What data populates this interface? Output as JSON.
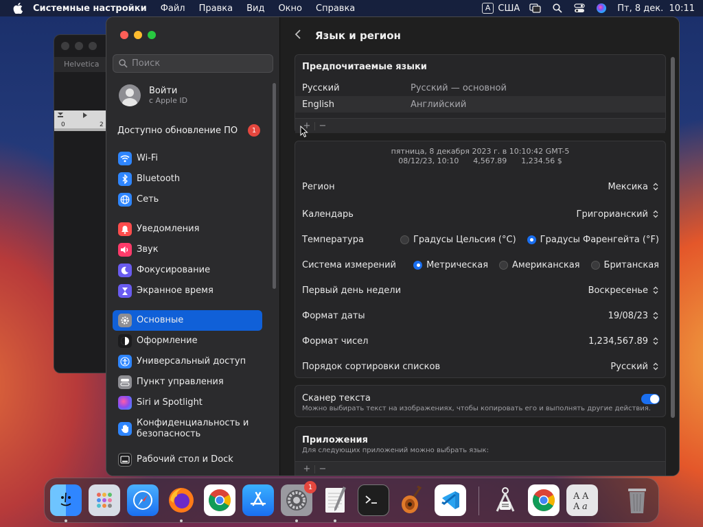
{
  "menubar": {
    "app_name": "Системные настройки",
    "items": [
      "Файл",
      "Правка",
      "Вид",
      "Окно",
      "Справка"
    ],
    "input_source_letter": "A",
    "input_source": "США",
    "datetime": "Пт, 8 дек.  10:11"
  },
  "background_window": {
    "tab": "Helvetica",
    "ruler_start": "0",
    "ruler_mark": "2"
  },
  "sidebar": {
    "search_placeholder": "Поиск",
    "account": {
      "title": "Войти",
      "subtitle": "с Apple ID"
    },
    "update": {
      "label": "Доступно обновление ПО",
      "badge": "1"
    },
    "group1": [
      {
        "label": "Wi-Fi",
        "icon": "wifi-icon",
        "color": "#2f86ff"
      },
      {
        "label": "Bluetooth",
        "icon": "bluetooth-icon",
        "color": "#2f86ff"
      },
      {
        "label": "Сеть",
        "icon": "globe-icon",
        "color": "#2f86ff"
      }
    ],
    "group2": [
      {
        "label": "Уведомления",
        "icon": "bell-icon",
        "color": "#ff4d4d"
      },
      {
        "label": "Звук",
        "icon": "speaker-icon",
        "color": "#ff3b6a"
      },
      {
        "label": "Фокусирование",
        "icon": "moon-icon",
        "color": "#6a5cf0"
      },
      {
        "label": "Экранное время",
        "icon": "hourglass-icon",
        "color": "#6a5cf0"
      }
    ],
    "group3": [
      {
        "label": "Основные",
        "icon": "gear-icon",
        "color": "#8e8e93"
      },
      {
        "label": "Оформление",
        "icon": "appearance-icon",
        "color": "#1c1c1e"
      },
      {
        "label": "Универсальный доступ",
        "icon": "accessibility-icon",
        "color": "#2f86ff"
      },
      {
        "label": "Пункт управления",
        "icon": "control-center-icon",
        "color": "#8e8e93"
      },
      {
        "label": "Siri и Spotlight",
        "icon": "siri-icon",
        "color": "#b04ce0"
      },
      {
        "label": "Конфиденциальность и безопасность",
        "icon": "hand-icon",
        "color": "#2f86ff"
      }
    ],
    "group4": [
      {
        "label": "Рабочий стол и Dock",
        "icon": "dock-icon",
        "color": "#1c1c1e"
      }
    ]
  },
  "content": {
    "title": "Язык и регион",
    "preferred": {
      "header": "Предпочитаемые языки",
      "languages": [
        {
          "name": "Русский",
          "desc": "Русский — основной"
        },
        {
          "name": "English",
          "desc": "Английский"
        }
      ],
      "add": "+",
      "remove": "−"
    },
    "preview": {
      "line1": "пятница, 8 декабря 2023 г. в 10:10:42 GMT-5",
      "line2": "08/12/23, 10:10      4,567.89      1,234.56 $"
    },
    "settings": {
      "region": {
        "label": "Регион",
        "value": "Мексика"
      },
      "calendar": {
        "label": "Календарь",
        "value": "Григорианский"
      },
      "temperature": {
        "label": "Температура",
        "options": [
          "Градусы Цельсия (°C)",
          "Градусы Фаренгейта (°F)"
        ],
        "selected": 1
      },
      "measurement": {
        "label": "Система измерений",
        "options": [
          "Метрическая",
          "Американская",
          "Британская"
        ],
        "selected": 0
      },
      "first_day": {
        "label": "Первый день недели",
        "value": "Воскресенье"
      },
      "date_format": {
        "label": "Формат даты",
        "value": "19/08/23"
      },
      "number_format": {
        "label": "Формат чисел",
        "value": "1,234,567.89"
      },
      "sort_order": {
        "label": "Порядок сортировки списков",
        "value": "Русский"
      }
    },
    "live_text": {
      "title": "Сканер текста",
      "desc": "Можно выбирать текст на изображениях, чтобы копировать его и выполнять другие действия.",
      "enabled": true
    },
    "apps": {
      "title": "Приложения",
      "desc": "Для следующих приложений можно выбрать язык:",
      "add": "+",
      "remove": "−"
    }
  },
  "dock": {
    "apps": [
      "Finder",
      "Launchpad",
      "Safari",
      "Firefox",
      "Chrome",
      "App Store",
      "System Settings",
      "TextEdit",
      "Terminal",
      "GarageBand",
      "VS Code",
      "System Information",
      "Chrome",
      "Font Book",
      "Trash"
    ],
    "settings_badge": "1"
  }
}
